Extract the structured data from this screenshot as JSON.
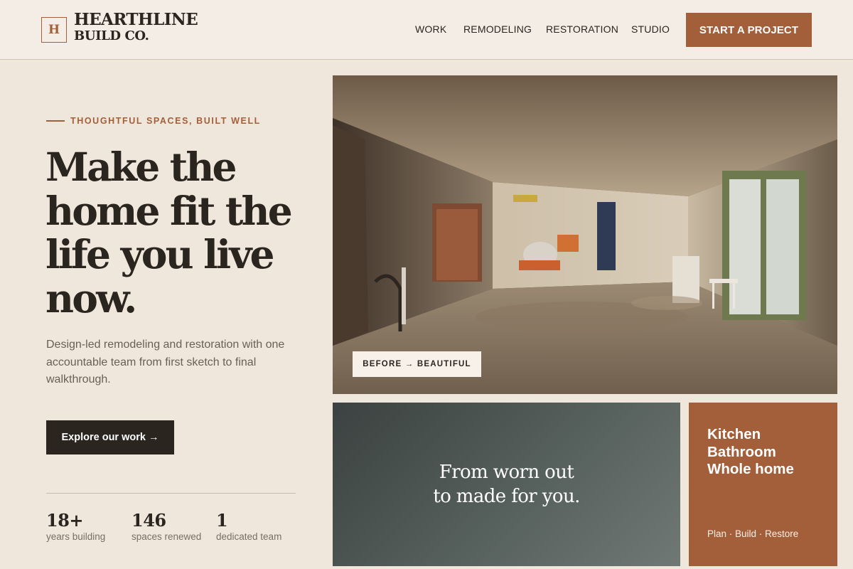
{
  "brand": {
    "mark": "H",
    "name_line1": "HEARTHLINE",
    "name_line2": "BUILD CO."
  },
  "nav": {
    "items": [
      "WORK",
      "REMODELING",
      "RESTORATION",
      "STUDIO"
    ],
    "cta": "START A PROJECT"
  },
  "hero": {
    "eyebrow": "THOUGHTFUL SPACES, BUILT WELL",
    "headline_lines": [
      "Make the",
      "home fit the",
      "life you live",
      "now."
    ],
    "lede": "Design-led remodeling and restoration with one accountable team from first sketch to final walkthrough.",
    "button": "Explore our work →"
  },
  "stats": [
    {
      "value": "18+",
      "label": "years building"
    },
    {
      "value": "146",
      "label": "spaces renewed"
    },
    {
      "value": "1",
      "label": "dedicated team"
    }
  ],
  "photo": {
    "badge": "BEFORE → BEAUTIFUL"
  },
  "panels": {
    "quote_lines": [
      "From worn out",
      "to made for you."
    ],
    "services": [
      "Kitchen",
      "Bathroom",
      "Whole home"
    ],
    "tagline": "Plan · Build · Restore"
  },
  "colors": {
    "accent": "#a35f3a",
    "dark": "#2b2520",
    "background": "#efe7dc"
  }
}
